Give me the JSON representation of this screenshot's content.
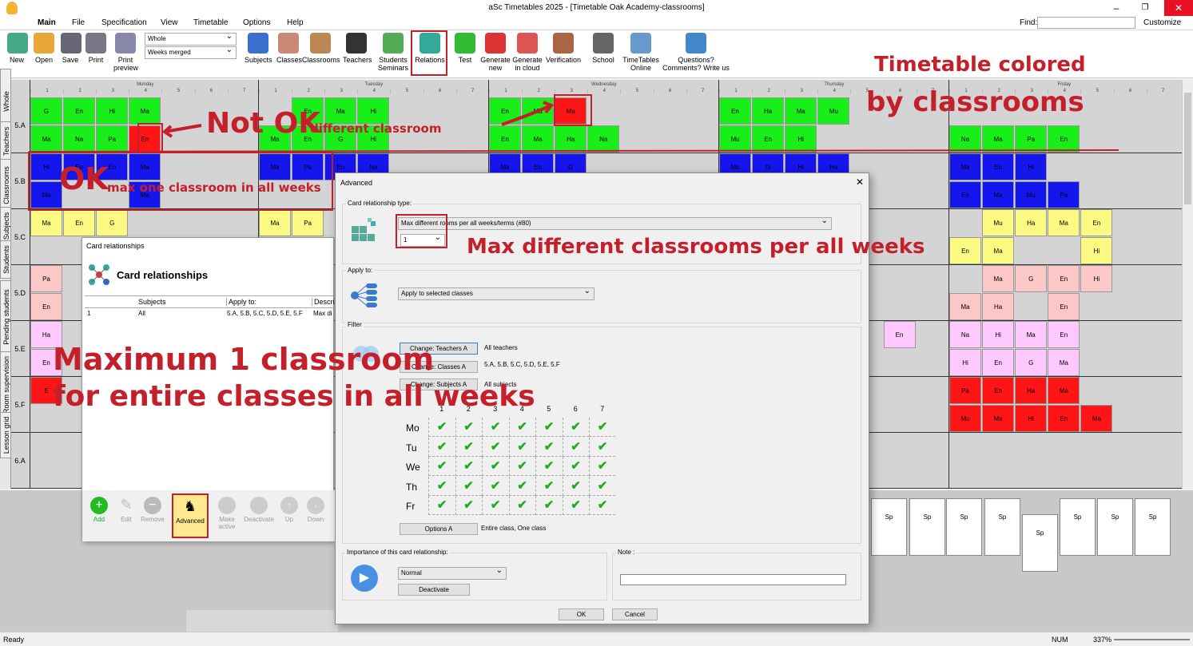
{
  "window": {
    "title": "aSc Timetables 2025  - [Timetable Oak Academy-classrooms]",
    "find_label": "Find:",
    "customize": "Customize"
  },
  "menu": [
    "Main",
    "File",
    "Specification",
    "View",
    "Timetable",
    "Options",
    "Help"
  ],
  "ribbon": {
    "view_select": "Whole",
    "weeks_select": "Weeks merged",
    "buttons": [
      {
        "label": "New",
        "color": "#4a8"
      },
      {
        "label": "Open",
        "color": "#e8a838"
      },
      {
        "label": "Save",
        "color": "#667"
      },
      {
        "label": "Print",
        "color": "#778"
      },
      {
        "label": "Print preview",
        "color": "#88a"
      },
      {
        "label": "Subjects",
        "color": "#3a6fd0"
      },
      {
        "label": "Classes",
        "color": "#c87"
      },
      {
        "label": "Classrooms",
        "color": "#b85"
      },
      {
        "label": "Teachers",
        "color": "#333"
      },
      {
        "label": "Students Seminars",
        "color": "#5a5"
      },
      {
        "label": "Relations",
        "color": "#3a9"
      },
      {
        "label": "Test",
        "color": "#3b3"
      },
      {
        "label": "Generate new",
        "color": "#d33"
      },
      {
        "label": "Generate in cloud",
        "color": "#d55"
      },
      {
        "label": "Verification",
        "color": "#a64"
      },
      {
        "label": "School",
        "color": "#666"
      },
      {
        "label": "TimeTables Online",
        "color": "#69c"
      },
      {
        "label": "Questions? Comments? Write us",
        "color": "#48c"
      }
    ]
  },
  "side_tabs": [
    "Whole",
    "Teachers",
    "Classrooms",
    "Subjects",
    "Students",
    "Pending students",
    "Room supervision",
    "Lesson grid"
  ],
  "days": [
    "Monday",
    "Tuesday",
    "Wednesday",
    "Thursday",
    "Friday"
  ],
  "periods": [
    "1",
    "2",
    "3",
    "4",
    "5",
    "6",
    "7"
  ],
  "classes": [
    "5.A",
    "5.B",
    "5.C",
    "5.D",
    "5.E",
    "5.F",
    "6.A"
  ],
  "grid_cards": [
    {
      "t": "G",
      "c": "g",
      "d": 0,
      "p": 0,
      "r": 0,
      "h": 0
    },
    {
      "t": "En",
      "c": "g",
      "d": 0,
      "p": 1,
      "r": 0,
      "h": 0
    },
    {
      "t": "Hi",
      "c": "g",
      "d": 0,
      "p": 2,
      "r": 0,
      "h": 0
    },
    {
      "t": "Ma",
      "c": "g",
      "d": 0,
      "p": 3,
      "r": 0,
      "h": 0
    },
    {
      "t": "Ma",
      "c": "g",
      "d": 0,
      "p": 0,
      "r": 0,
      "h": 1
    },
    {
      "t": "Na",
      "c": "g",
      "d": 0,
      "p": 1,
      "r": 0,
      "h": 1
    },
    {
      "t": "Pa",
      "c": "g",
      "d": 0,
      "p": 2,
      "r": 0,
      "h": 1
    },
    {
      "t": "En",
      "c": "r",
      "d": 0,
      "p": 3,
      "r": 0,
      "h": 1
    },
    {
      "t": "En",
      "c": "g",
      "d": 1,
      "p": 1,
      "r": 0,
      "h": 0
    },
    {
      "t": "Ma",
      "c": "g",
      "d": 1,
      "p": 2,
      "r": 0,
      "h": 0
    },
    {
      "t": "Hi",
      "c": "g",
      "d": 1,
      "p": 3,
      "r": 0,
      "h": 0
    },
    {
      "t": "Ma",
      "c": "g",
      "d": 1,
      "p": 0,
      "r": 0,
      "h": 1
    },
    {
      "t": "En",
      "c": "g",
      "d": 1,
      "p": 1,
      "r": 0,
      "h": 1
    },
    {
      "t": "G",
      "c": "g",
      "d": 1,
      "p": 2,
      "r": 0,
      "h": 1
    },
    {
      "t": "Hi",
      "c": "g",
      "d": 1,
      "p": 3,
      "r": 0,
      "h": 1
    },
    {
      "t": "En",
      "c": "g",
      "d": 2,
      "p": 0,
      "r": 0,
      "h": 0
    },
    {
      "t": "Ma",
      "c": "g",
      "d": 2,
      "p": 1,
      "r": 0,
      "h": 0
    },
    {
      "t": "Ma",
      "c": "r",
      "d": 2,
      "p": 2,
      "r": 0,
      "h": 0
    },
    {
      "t": "En",
      "c": "g",
      "d": 2,
      "p": 0,
      "r": 0,
      "h": 1
    },
    {
      "t": "Ma",
      "c": "g",
      "d": 2,
      "p": 1,
      "r": 0,
      "h": 1
    },
    {
      "t": "Ha",
      "c": "g",
      "d": 2,
      "p": 2,
      "r": 0,
      "h": 1
    },
    {
      "t": "Na",
      "c": "g",
      "d": 2,
      "p": 3,
      "r": 0,
      "h": 1
    },
    {
      "t": "En",
      "c": "g",
      "d": 3,
      "p": 0,
      "r": 0,
      "h": 0
    },
    {
      "t": "Ha",
      "c": "g",
      "d": 3,
      "p": 1,
      "r": 0,
      "h": 0
    },
    {
      "t": "Ma",
      "c": "g",
      "d": 3,
      "p": 2,
      "r": 0,
      "h": 0
    },
    {
      "t": "Mu",
      "c": "g",
      "d": 3,
      "p": 3,
      "r": 0,
      "h": 0
    },
    {
      "t": "Mu",
      "c": "g",
      "d": 3,
      "p": 0,
      "r": 0,
      "h": 1
    },
    {
      "t": "En",
      "c": "g",
      "d": 3,
      "p": 1,
      "r": 0,
      "h": 1
    },
    {
      "t": "Hi",
      "c": "g",
      "d": 3,
      "p": 2,
      "r": 0,
      "h": 1
    },
    {
      "t": "Na",
      "c": "g",
      "d": 4,
      "p": 0,
      "r": 0,
      "h": 1
    },
    {
      "t": "Ma",
      "c": "g",
      "d": 4,
      "p": 1,
      "r": 0,
      "h": 1
    },
    {
      "t": "Pa",
      "c": "g",
      "d": 4,
      "p": 2,
      "r": 0,
      "h": 1
    },
    {
      "t": "En",
      "c": "g",
      "d": 4,
      "p": 3,
      "r": 0,
      "h": 1
    },
    {
      "t": "Hi",
      "c": "b",
      "d": 0,
      "p": 0,
      "r": 1,
      "h": 0
    },
    {
      "t": "En",
      "c": "b",
      "d": 0,
      "p": 1,
      "r": 1,
      "h": 0
    },
    {
      "t": "En",
      "c": "b",
      "d": 0,
      "p": 2,
      "r": 1,
      "h": 0
    },
    {
      "t": "Ma",
      "c": "b",
      "d": 0,
      "p": 3,
      "r": 1,
      "h": 0
    },
    {
      "t": "Ma",
      "c": "b",
      "d": 0,
      "p": 0,
      "r": 1,
      "h": 1
    },
    {
      "t": "Ma",
      "c": "b",
      "d": 0,
      "p": 3,
      "r": 1,
      "h": 1
    },
    {
      "t": "Ma",
      "c": "b",
      "d": 1,
      "p": 0,
      "r": 1,
      "h": 0
    },
    {
      "t": "Pa",
      "c": "b",
      "d": 1,
      "p": 1,
      "r": 1,
      "h": 0
    },
    {
      "t": "En",
      "c": "b",
      "d": 1,
      "p": 2,
      "r": 1,
      "h": 0
    },
    {
      "t": "Na",
      "c": "b",
      "d": 1,
      "p": 3,
      "r": 1,
      "h": 0
    },
    {
      "t": "Ma",
      "c": "b",
      "d": 2,
      "p": 0,
      "r": 1,
      "h": 0
    },
    {
      "t": "En",
      "c": "b",
      "d": 2,
      "p": 1,
      "r": 1,
      "h": 0
    },
    {
      "t": "G",
      "c": "b",
      "d": 2,
      "p": 2,
      "r": 1,
      "h": 0
    },
    {
      "t": "Mu",
      "c": "b",
      "d": 3,
      "p": 0,
      "r": 1,
      "h": 0
    },
    {
      "t": "G",
      "c": "b",
      "d": 3,
      "p": 1,
      "r": 1,
      "h": 0
    },
    {
      "t": "Hi",
      "c": "b",
      "d": 3,
      "p": 2,
      "r": 1,
      "h": 0
    },
    {
      "t": "Ha",
      "c": "b",
      "d": 3,
      "p": 3,
      "r": 1,
      "h": 0
    },
    {
      "t": "Ma",
      "c": "b",
      "d": 4,
      "p": 0,
      "r": 1,
      "h": 0
    },
    {
      "t": "En",
      "c": "b",
      "d": 4,
      "p": 1,
      "r": 1,
      "h": 0
    },
    {
      "t": "Hi",
      "c": "b",
      "d": 4,
      "p": 2,
      "r": 1,
      "h": 0
    },
    {
      "t": "En",
      "c": "b",
      "d": 4,
      "p": 0,
      "r": 1,
      "h": 1
    },
    {
      "t": "Ma",
      "c": "b",
      "d": 4,
      "p": 1,
      "r": 1,
      "h": 1
    },
    {
      "t": "Mu",
      "c": "b",
      "d": 4,
      "p": 2,
      "r": 1,
      "h": 1
    },
    {
      "t": "Pa",
      "c": "b",
      "d": 4,
      "p": 3,
      "r": 1,
      "h": 1
    },
    {
      "t": "Ma",
      "c": "y",
      "d": 0,
      "p": 0,
      "r": 2,
      "h": 0
    },
    {
      "t": "En",
      "c": "y",
      "d": 0,
      "p": 1,
      "r": 2,
      "h": 0
    },
    {
      "t": "G",
      "c": "y",
      "d": 0,
      "p": 2,
      "r": 2,
      "h": 0
    },
    {
      "t": "Ma",
      "c": "y",
      "d": 1,
      "p": 0,
      "r": 2,
      "h": 0
    },
    {
      "t": "Pa",
      "c": "y",
      "d": 1,
      "p": 1,
      "r": 2,
      "h": 0
    },
    {
      "t": "Mu",
      "c": "y",
      "d": 4,
      "p": 1,
      "r": 2,
      "h": 0
    },
    {
      "t": "Ha",
      "c": "y",
      "d": 4,
      "p": 2,
      "r": 2,
      "h": 0
    },
    {
      "t": "Ma",
      "c": "y",
      "d": 4,
      "p": 3,
      "r": 2,
      "h": 0
    },
    {
      "t": "En",
      "c": "y",
      "d": 4,
      "p": 4,
      "r": 2,
      "h": 0
    },
    {
      "t": "En",
      "c": "y",
      "d": 4,
      "p": 0,
      "r": 2,
      "h": 1
    },
    {
      "t": "Ma",
      "c": "y",
      "d": 4,
      "p": 1,
      "r": 2,
      "h": 1
    },
    {
      "t": "Hi",
      "c": "y",
      "d": 4,
      "p": 4,
      "r": 2,
      "h": 1
    },
    {
      "t": "Pa",
      "c": "rp",
      "d": 0,
      "p": 0,
      "r": 3,
      "h": 0
    },
    {
      "t": "En",
      "c": "rp",
      "d": 0,
      "p": 0,
      "r": 3,
      "h": 1
    },
    {
      "t": "Ma",
      "c": "rp",
      "d": 4,
      "p": 1,
      "r": 3,
      "h": 0
    },
    {
      "t": "G",
      "c": "rp",
      "d": 4,
      "p": 2,
      "r": 3,
      "h": 0
    },
    {
      "t": "En",
      "c": "rp",
      "d": 4,
      "p": 3,
      "r": 3,
      "h": 0
    },
    {
      "t": "Hi",
      "c": "rp",
      "d": 4,
      "p": 4,
      "r": 3,
      "h": 0
    },
    {
      "t": "Ma",
      "c": "rp",
      "d": 4,
      "p": 0,
      "r": 3,
      "h": 1
    },
    {
      "t": "Ha",
      "c": "rp",
      "d": 4,
      "p": 1,
      "r": 3,
      "h": 1
    },
    {
      "t": "En",
      "c": "rp",
      "d": 4,
      "p": 3,
      "r": 3,
      "h": 1
    },
    {
      "t": "Ha",
      "c": "p",
      "d": 0,
      "p": 0,
      "r": 4,
      "h": 0
    },
    {
      "t": "En",
      "c": "p",
      "d": 0,
      "p": 0,
      "r": 4,
      "h": 1
    },
    {
      "t": "En",
      "c": "p",
      "d": 3,
      "p": 5,
      "r": 4,
      "h": 0
    },
    {
      "t": "Na",
      "c": "p",
      "d": 4,
      "p": 0,
      "r": 4,
      "h": 0
    },
    {
      "t": "Hi",
      "c": "p",
      "d": 4,
      "p": 1,
      "r": 4,
      "h": 0
    },
    {
      "t": "Ma",
      "c": "p",
      "d": 4,
      "p": 2,
      "r": 4,
      "h": 0
    },
    {
      "t": "En",
      "c": "p",
      "d": 4,
      "p": 3,
      "r": 4,
      "h": 0
    },
    {
      "t": "Hi",
      "c": "p",
      "d": 4,
      "p": 0,
      "r": 4,
      "h": 1
    },
    {
      "t": "En",
      "c": "p",
      "d": 4,
      "p": 1,
      "r": 4,
      "h": 1
    },
    {
      "t": "G",
      "c": "p",
      "d": 4,
      "p": 2,
      "r": 4,
      "h": 1
    },
    {
      "t": "Ma",
      "c": "p",
      "d": 4,
      "p": 3,
      "r": 4,
      "h": 1
    },
    {
      "t": "E",
      "c": "r",
      "d": 0,
      "p": 0,
      "r": 5,
      "h": 0
    },
    {
      "t": "Pa",
      "c": "r",
      "d": 4,
      "p": 0,
      "r": 5,
      "h": 0
    },
    {
      "t": "En",
      "c": "r",
      "d": 4,
      "p": 1,
      "r": 5,
      "h": 0
    },
    {
      "t": "Ha",
      "c": "r",
      "d": 4,
      "p": 2,
      "r": 5,
      "h": 0
    },
    {
      "t": "Ma",
      "c": "r",
      "d": 4,
      "p": 3,
      "r": 5,
      "h": 0
    },
    {
      "t": "Mu",
      "c": "r",
      "d": 4,
      "p": 0,
      "r": 5,
      "h": 1
    },
    {
      "t": "Ma",
      "c": "r",
      "d": 4,
      "p": 1,
      "r": 5,
      "h": 1
    },
    {
      "t": "Hi",
      "c": "r",
      "d": 4,
      "p": 2,
      "r": 5,
      "h": 1
    },
    {
      "t": "En",
      "c": "r",
      "d": 4,
      "p": 3,
      "r": 5,
      "h": 1
    },
    {
      "t": "Ma",
      "c": "r",
      "d": 4,
      "p": 4,
      "r": 5,
      "h": 1
    }
  ],
  "bottom_cards": [
    "Sp",
    "Sp",
    "Sp",
    "Sp",
    "Sp",
    "Sp",
    "Sp",
    "Sp"
  ],
  "status": {
    "left": "Ready",
    "num": "NUM",
    "zoom": "337%"
  },
  "card_relationships": {
    "title": "Card relationships",
    "heading": "Card relationships",
    "columns": [
      "",
      "Subjects",
      "Apply to:",
      "Descrip"
    ],
    "rows": [
      [
        "1",
        "All",
        "5.A, 5.B, 5.C, 5.D, 5.E, 5.F",
        "Max di"
      ]
    ],
    "buttons": [
      "Add",
      "Edit",
      "Remove",
      "Advanced",
      "Make active",
      "Deactivate",
      "Up",
      "Down"
    ]
  },
  "advanced": {
    "title": "Advanced",
    "type_label": "Card relationship type:",
    "type_value": "Max different rooms per all weeks/terms (#80)",
    "count_value": "1",
    "apply_label": "Apply to:",
    "apply_value": "Apply to selected classes",
    "filter_label": "Filter",
    "teachers_btn": "Change: Teachers A",
    "teachers_val": "All teachers",
    "classes_btn": "Change: Classes A",
    "classes_val": "5.A, 5.B, 5.C, 5.D, 5.E, 5.F",
    "subjects_btn": "Change: Subjects A",
    "subjects_val": "All subjects",
    "days": [
      "Mo",
      "Tu",
      "We",
      "Th",
      "Fr"
    ],
    "periods": [
      "1",
      "2",
      "3",
      "4",
      "5",
      "6",
      "7"
    ],
    "options_btn": "Options A",
    "options_val": "Entire class, One class",
    "importance_label": "Importance of this card relationship:",
    "importance_value": "Normal",
    "deactivate_btn": "Deactivate",
    "note_label": "Note :",
    "ok": "OK",
    "cancel": "Cancel"
  },
  "annotations": {
    "timetable_colored": "Timetable colored",
    "by_classrooms": "by classrooms",
    "not_ok": "Not OK",
    "different_classroom": "different classroom",
    "ok": "OK",
    "max_one": "max one classroom in all weeks",
    "max_diff": "Max different classrooms per all weeks",
    "max1": "Maximum 1 classroom",
    "entire": "for entire classes in all weeks"
  },
  "colors": {
    "annotation": "#c4202b",
    "green": "#18ee18",
    "blue": "#1515ee",
    "red": "#ff1515",
    "yellow": "#fbfb84"
  }
}
